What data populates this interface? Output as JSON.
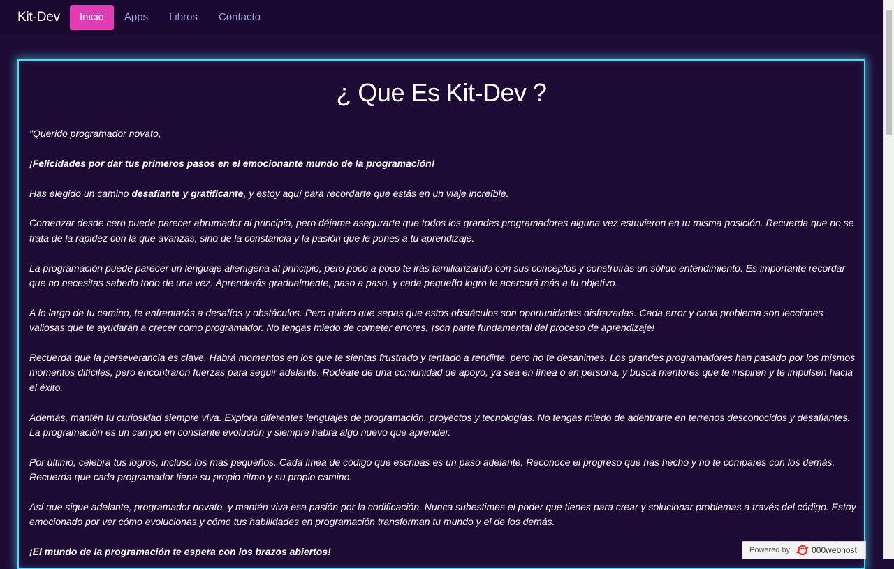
{
  "nav": {
    "brand": "Kit-Dev",
    "items": [
      {
        "label": "Inicio",
        "active": true
      },
      {
        "label": "Apps",
        "active": false
      },
      {
        "label": "Libros",
        "active": false
      },
      {
        "label": "Contacto",
        "active": false
      }
    ]
  },
  "main": {
    "title": "¿ Que Es Kit-Dev ?",
    "p1": "\"Querido programador novato,",
    "p2": "¡Felicidades por dar tus primeros pasos en el emocionante mundo de la programación!",
    "p3_a": "Has elegido un camino ",
    "p3_b": "desafiante y gratificante",
    "p3_c": ", y estoy aquí para recordarte que estás en un viaje increíble.",
    "p4": "Comenzar desde cero puede parecer abrumador al principio, pero déjame asegurarte que todos los grandes programadores alguna vez estuvieron en tu misma posición. Recuerda que no se trata de la rapidez con la que avanzas, sino de la constancia y la pasión que le pones a tu aprendizaje.",
    "p5": "La programación puede parecer un lenguaje alienígena al principio, pero poco a poco te irás familiarizando con sus conceptos y construirás un sólido entendimiento. Es importante recordar que no necesitas saberlo todo de una vez. Aprenderás gradualmente, paso a paso, y cada pequeño logro te acercará más a tu objetivo.",
    "p6": "A lo largo de tu camino, te enfrentarás a desafíos y obstáculos. Pero quiero que sepas que estos obstáculos son oportunidades disfrazadas. Cada error y cada problema son lecciones valiosas que te ayudarán a crecer como programador. No tengas miedo de cometer errores, ¡son parte fundamental del proceso de aprendizaje!",
    "p7": "Recuerda que la perseverancia es clave. Habrá momentos en los que te sientas frustrado y tentado a rendirte, pero no te desanimes. Los grandes programadores han pasado por los mismos momentos difíciles, pero encontraron fuerzas para seguir adelante. Rodéate de una comunidad de apoyo, ya sea en línea o en persona, y busca mentores que te inspiren y te impulsen hacia el éxito.",
    "p8": "Además, mantén tu curiosidad siempre viva. Explora diferentes lenguajes de programación, proyectos y tecnologías. No tengas miedo de adentrarte en terrenos desconocidos y desafiantes. La programación es un campo en constante evolución y siempre habrá algo nuevo que aprender.",
    "p9": "Por último, celebra tus logros, incluso los más pequeños. Cada línea de código que escribas es un paso adelante. Reconoce el progreso que has hecho y no te compares con los demás. Recuerda que cada programador tiene su propio ritmo y su propio camino.",
    "p10": "Así que sigue adelante, programador novato, y mantén viva esa pasión por la codificación. Nunca subestimes el poder que tienes para crear y solucionar problemas a través del código. Estoy emocionado por ver cómo evolucionas y cómo tus habilidades en programación transforman tu mundo y el de los demás.",
    "p11": "¡El mundo de la programación te espera con los brazos abiertos!"
  },
  "footer_badge": {
    "label": "Powered by",
    "host": "000webhost",
    "icon": "000webhost-logo-icon"
  },
  "colors": {
    "background": "#1d0b35",
    "navbar": "#1a0830",
    "active_tab": "#e23cb4",
    "nav_link": "#a2a3e8",
    "card_border": "#4fd9ee"
  }
}
